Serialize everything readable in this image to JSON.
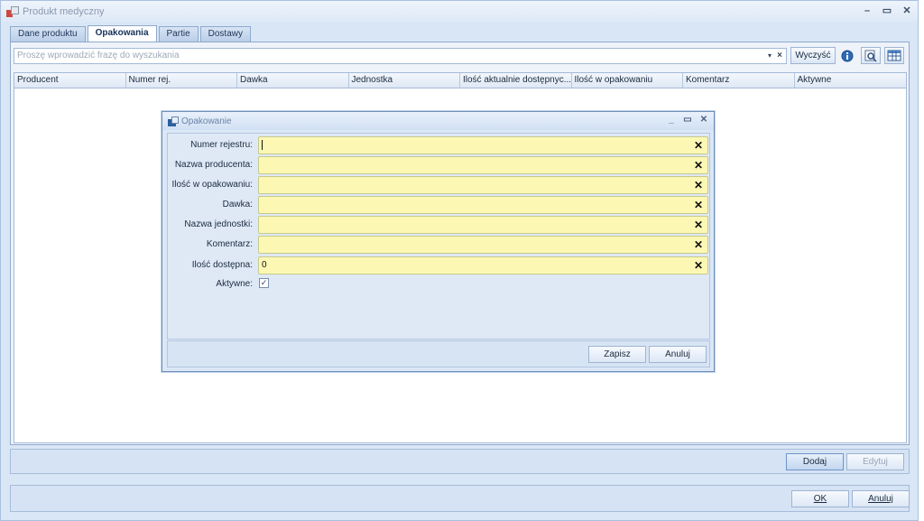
{
  "window": {
    "title": "Produkt medyczny",
    "controls": {
      "minimize": "–",
      "maximize": "▭",
      "close": "✕"
    }
  },
  "tabs": [
    {
      "label": "Dane produktu",
      "active": false
    },
    {
      "label": "Opakowania",
      "active": true
    },
    {
      "label": "Partie",
      "active": false
    },
    {
      "label": "Dostawy",
      "active": false
    }
  ],
  "search": {
    "placeholder": "Proszę wprowadzić frazę do wyszukania",
    "dropdown_glyph": "▾",
    "clear_glyph": "×",
    "clear_button": "Wyczyść"
  },
  "grid": {
    "columns": [
      "Producent",
      "Numer rej.",
      "Dawka",
      "Jednostka",
      "Ilość aktualnie dostępnyc...",
      "Ilość w opakowaniu",
      "Komentarz",
      "Aktywne"
    ]
  },
  "panel_footer": {
    "add_button": "Dodaj",
    "edit_button": "Edytuj"
  },
  "window_footer": {
    "ok_button": "OK",
    "cancel_button": "Anuluj"
  },
  "dialog": {
    "title": "Opakowanie",
    "controls": {
      "minimize": "_",
      "maximize": "▭",
      "close": "✕"
    },
    "fields": [
      {
        "label": "Numer rejestru:",
        "value": ""
      },
      {
        "label": "Nazwa producenta:",
        "value": ""
      },
      {
        "label": "Ilość w opakowaniu:",
        "value": ""
      },
      {
        "label": "Dawka:",
        "value": ""
      },
      {
        "label": "Nazwa jednostki:",
        "value": ""
      },
      {
        "label": "Komentarz:",
        "value": ""
      },
      {
        "label": "Ilość dostępna:",
        "value": "0"
      }
    ],
    "clear_glyph": "✕",
    "active_label": "Aktywne:",
    "active_checked": true,
    "check_glyph": "✓",
    "save_button": "Zapisz",
    "cancel_button": "Anuluj"
  },
  "colors": {
    "window_bg": "#d9e6f6",
    "input_highlight": "#fcf8b4",
    "border": "#8fa9cc"
  }
}
